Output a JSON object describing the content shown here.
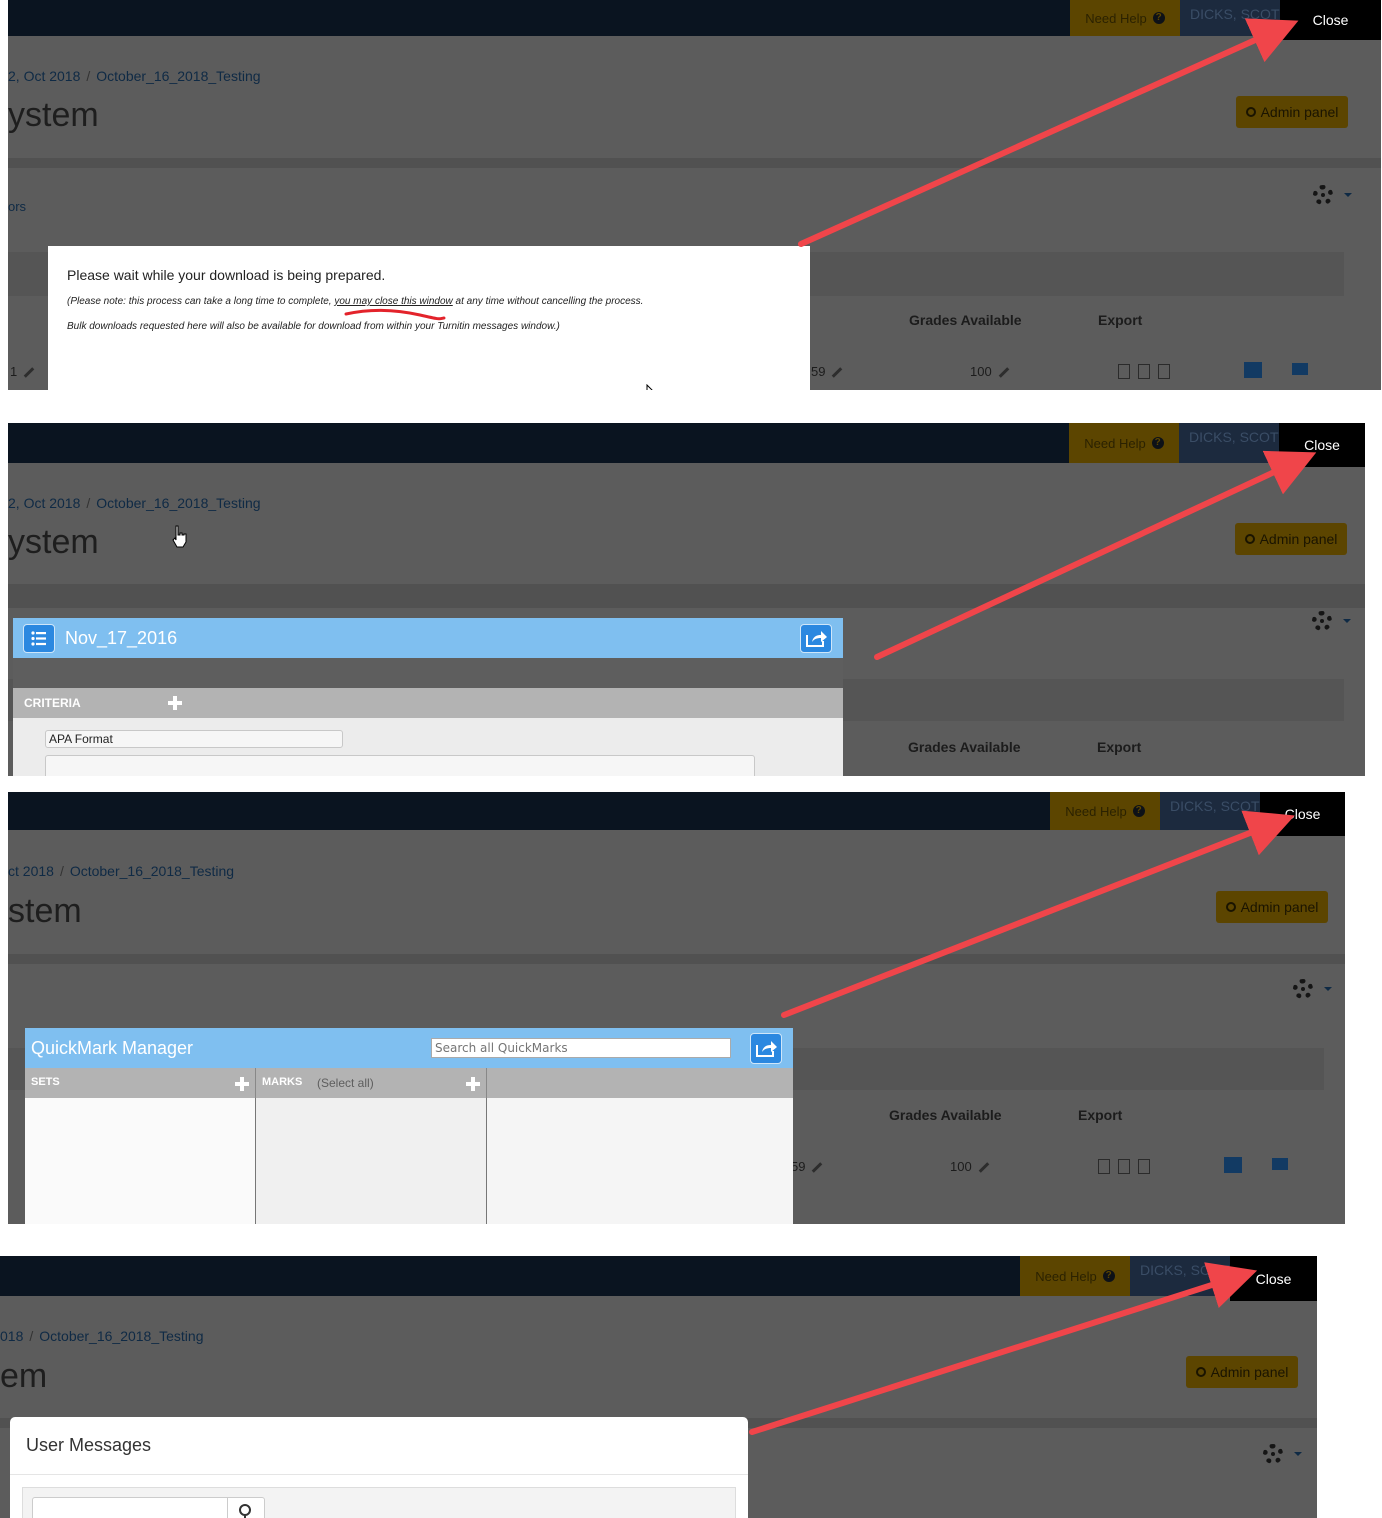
{
  "shared": {
    "need_help": "Need Help",
    "user_name": "DICKS, SCOTT",
    "close": "Close",
    "admin_panel": "Admin panel",
    "breadcrumb_last": "October_16_2018_Testing",
    "col_grades": "Grades Available",
    "col_export": "Export",
    "grades_value": "100",
    "partial_value": "59"
  },
  "panel1": {
    "crumb_first": "2, Oct 2018",
    "title": "ystem",
    "partial_link": "ors",
    "row_left": "1",
    "dialog": {
      "line1": "Please wait while your download is being prepared.",
      "line2_a": "(Please note: this process can take a long time to complete, ",
      "line2_b": "you may close this window",
      "line2_c": " at any time without cancelling the process.",
      "line3": "Bulk downloads requested here will also be available for download from within your Turnitin messages window.)"
    }
  },
  "panel2": {
    "crumb_first": "2, Oct 2018",
    "title": "ystem",
    "dialog_title": "Nov_17_2016",
    "criteria_label": "CRITERIA",
    "criteria_item": "APA Format"
  },
  "panel3": {
    "crumb_first": "ct 2018",
    "title": "stem",
    "dialog_title": "QuickMark Manager",
    "search_placeholder": "Search all QuickMarks",
    "sets_label": "SETS",
    "marks_label": "MARKS",
    "select_all": "(Select all)"
  },
  "panel4": {
    "crumb_first": "018",
    "title": "em",
    "dialog_title": "User Messages"
  },
  "colors": {
    "arrow": "#f0454a",
    "dialog_header_blue": "#7fbff0",
    "dim_background": "#5c5c5c"
  }
}
